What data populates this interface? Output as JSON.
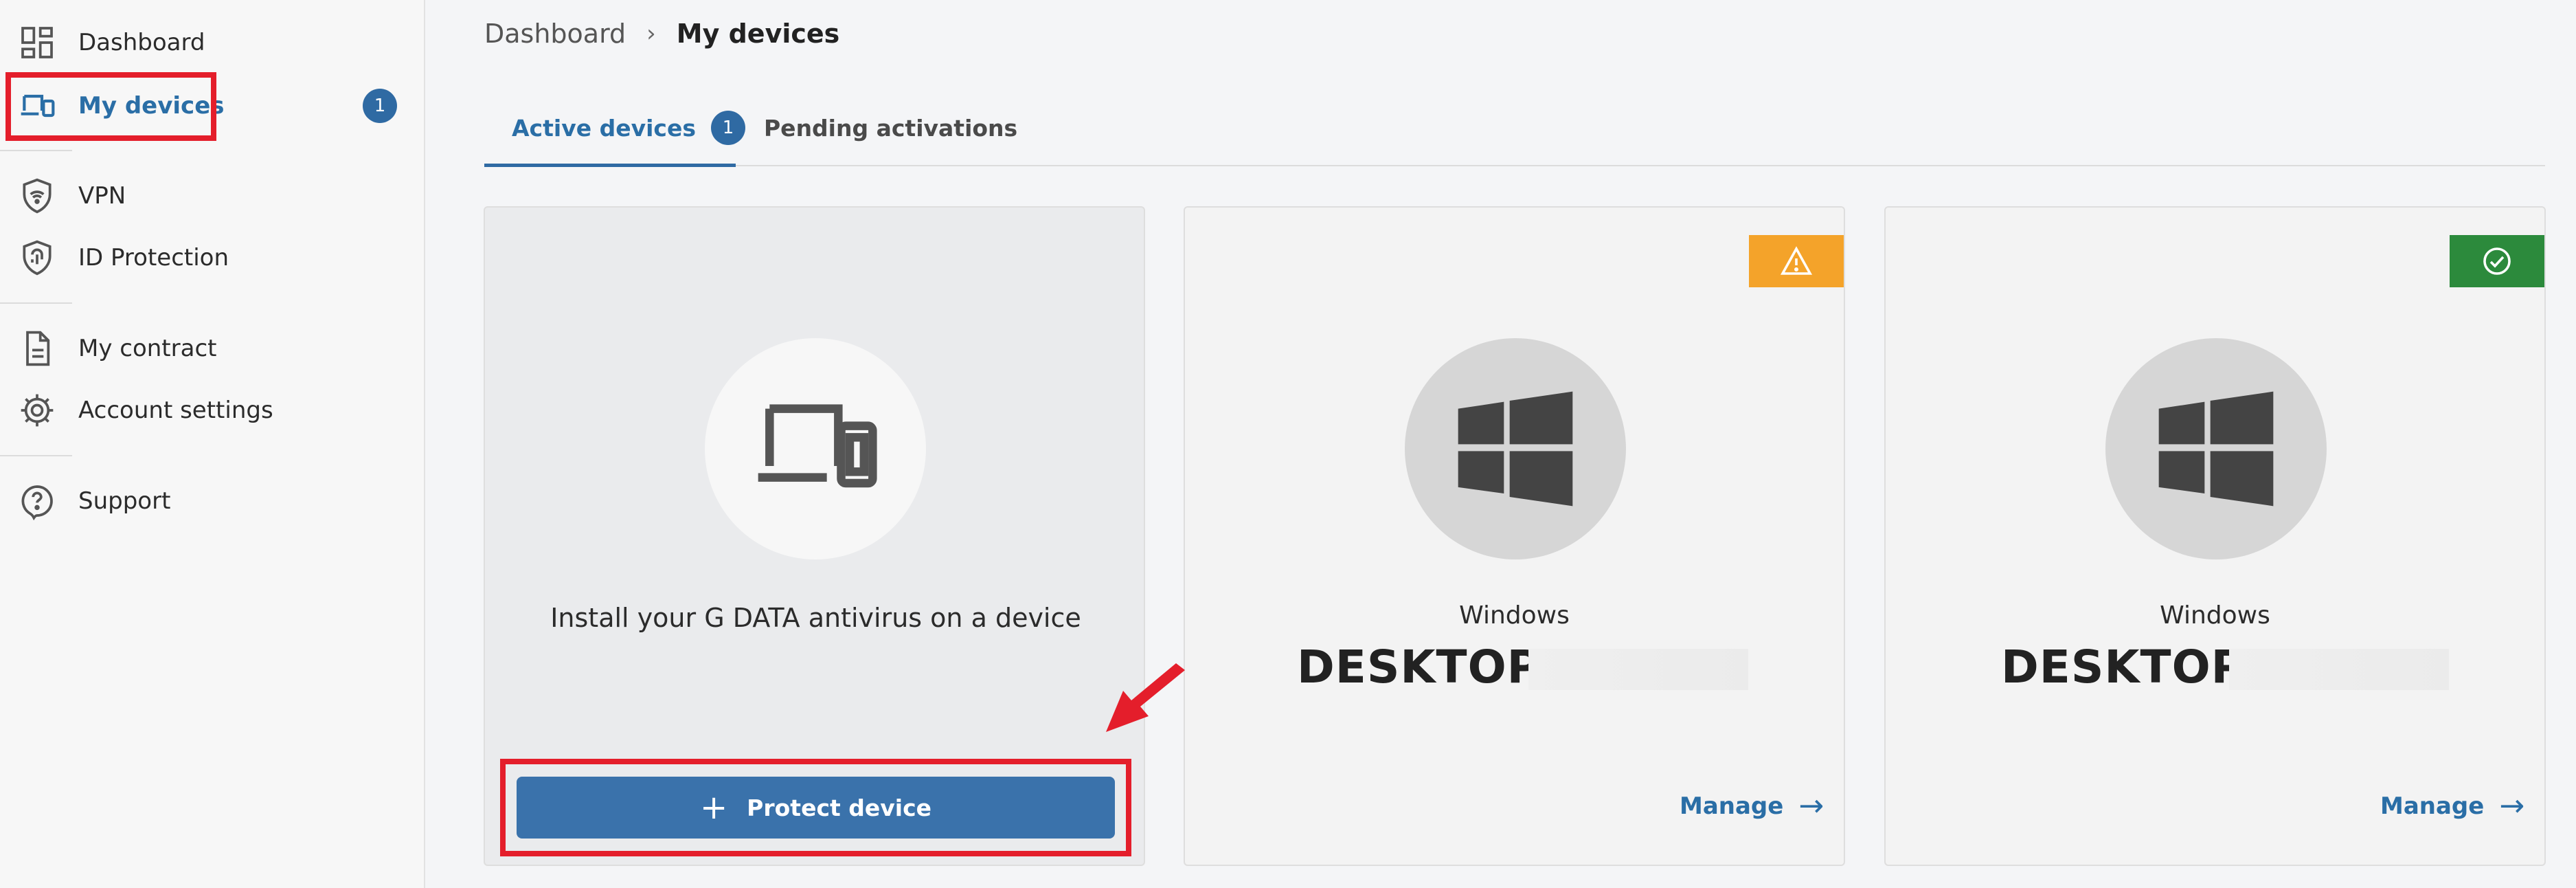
{
  "sidebar": {
    "items": [
      {
        "label": "Dashboard",
        "icon": "dashboard-icon"
      },
      {
        "label": "My devices",
        "icon": "devices-icon",
        "badge": "1",
        "active": true
      },
      {
        "label": "VPN",
        "icon": "vpn-shield-icon"
      },
      {
        "label": "ID Protection",
        "icon": "fingerprint-shield-icon"
      },
      {
        "label": "My contract",
        "icon": "document-icon"
      },
      {
        "label": "Account settings",
        "icon": "gear-icon"
      },
      {
        "label": "Support",
        "icon": "help-icon"
      }
    ]
  },
  "breadcrumb": {
    "home": "Dashboard",
    "separator": "›",
    "current": "My devices"
  },
  "tabs": [
    {
      "label": "Active devices",
      "badge": "1",
      "active": true
    },
    {
      "label": "Pending activations",
      "active": false
    }
  ],
  "install_card": {
    "text": "Install your G DATA antivirus on a device",
    "button_label": "Protect device",
    "button_icon": "plus-icon"
  },
  "devices": [
    {
      "os": "Windows",
      "name": "DESKTOP-",
      "status": "warning",
      "manage_label": "Manage"
    },
    {
      "os": "Windows",
      "name": "DESKTOP-",
      "status": "ok",
      "manage_label": "Manage"
    }
  ],
  "colors": {
    "accent": "#2f6aa3",
    "warning": "#f4a32a",
    "ok": "#2c8a3c",
    "annotation": "#e41e2b"
  }
}
